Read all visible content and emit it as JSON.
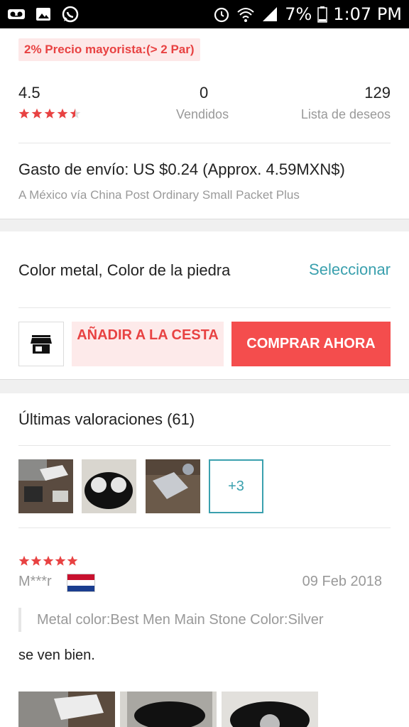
{
  "status_bar": {
    "battery": "7%",
    "time": "1:07 PM",
    "icons": [
      "voicemail-icon",
      "image-icon",
      "whatsapp-icon",
      "alarm-icon",
      "wifi-icon",
      "signal-icon",
      "battery-icon"
    ]
  },
  "wholesale_tag": "2% Precio mayorista:(> 2 Par)",
  "stats": {
    "rating": "4.5",
    "rating_value": 4.5,
    "sold_count": "0",
    "sold_label": "Vendidos",
    "wishlist_count": "129",
    "wishlist_label": "Lista de deseos"
  },
  "shipping": {
    "title": "Gasto de envío: US $0.24 (Approx. 4.59MXN$)",
    "method": "A México vía China Post Ordinary Small Packet Plus"
  },
  "variant": {
    "label": "Color metal, Color de la piedra",
    "action": "Seleccionar"
  },
  "actions": {
    "store_icon": "store-icon",
    "add_to_cart": "AÑADIR A LA CESTA",
    "buy_now": "COMPRAR AHORA"
  },
  "reviews": {
    "title": "Últimas valoraciones (61)",
    "more_photos": "+3",
    "items": [
      {
        "rating": 5,
        "reviewer": "M***r",
        "country_flag": "netherlands-flag",
        "date": "09 Feb 2018",
        "attributes": "Metal color:Best Men Main Stone Color:Silver",
        "text": "se ven bien."
      }
    ]
  },
  "colors": {
    "accent_red": "#f44d4d",
    "tag_red": "#e84242",
    "link_teal": "#3aa0ae",
    "star_red": "#e84242"
  }
}
